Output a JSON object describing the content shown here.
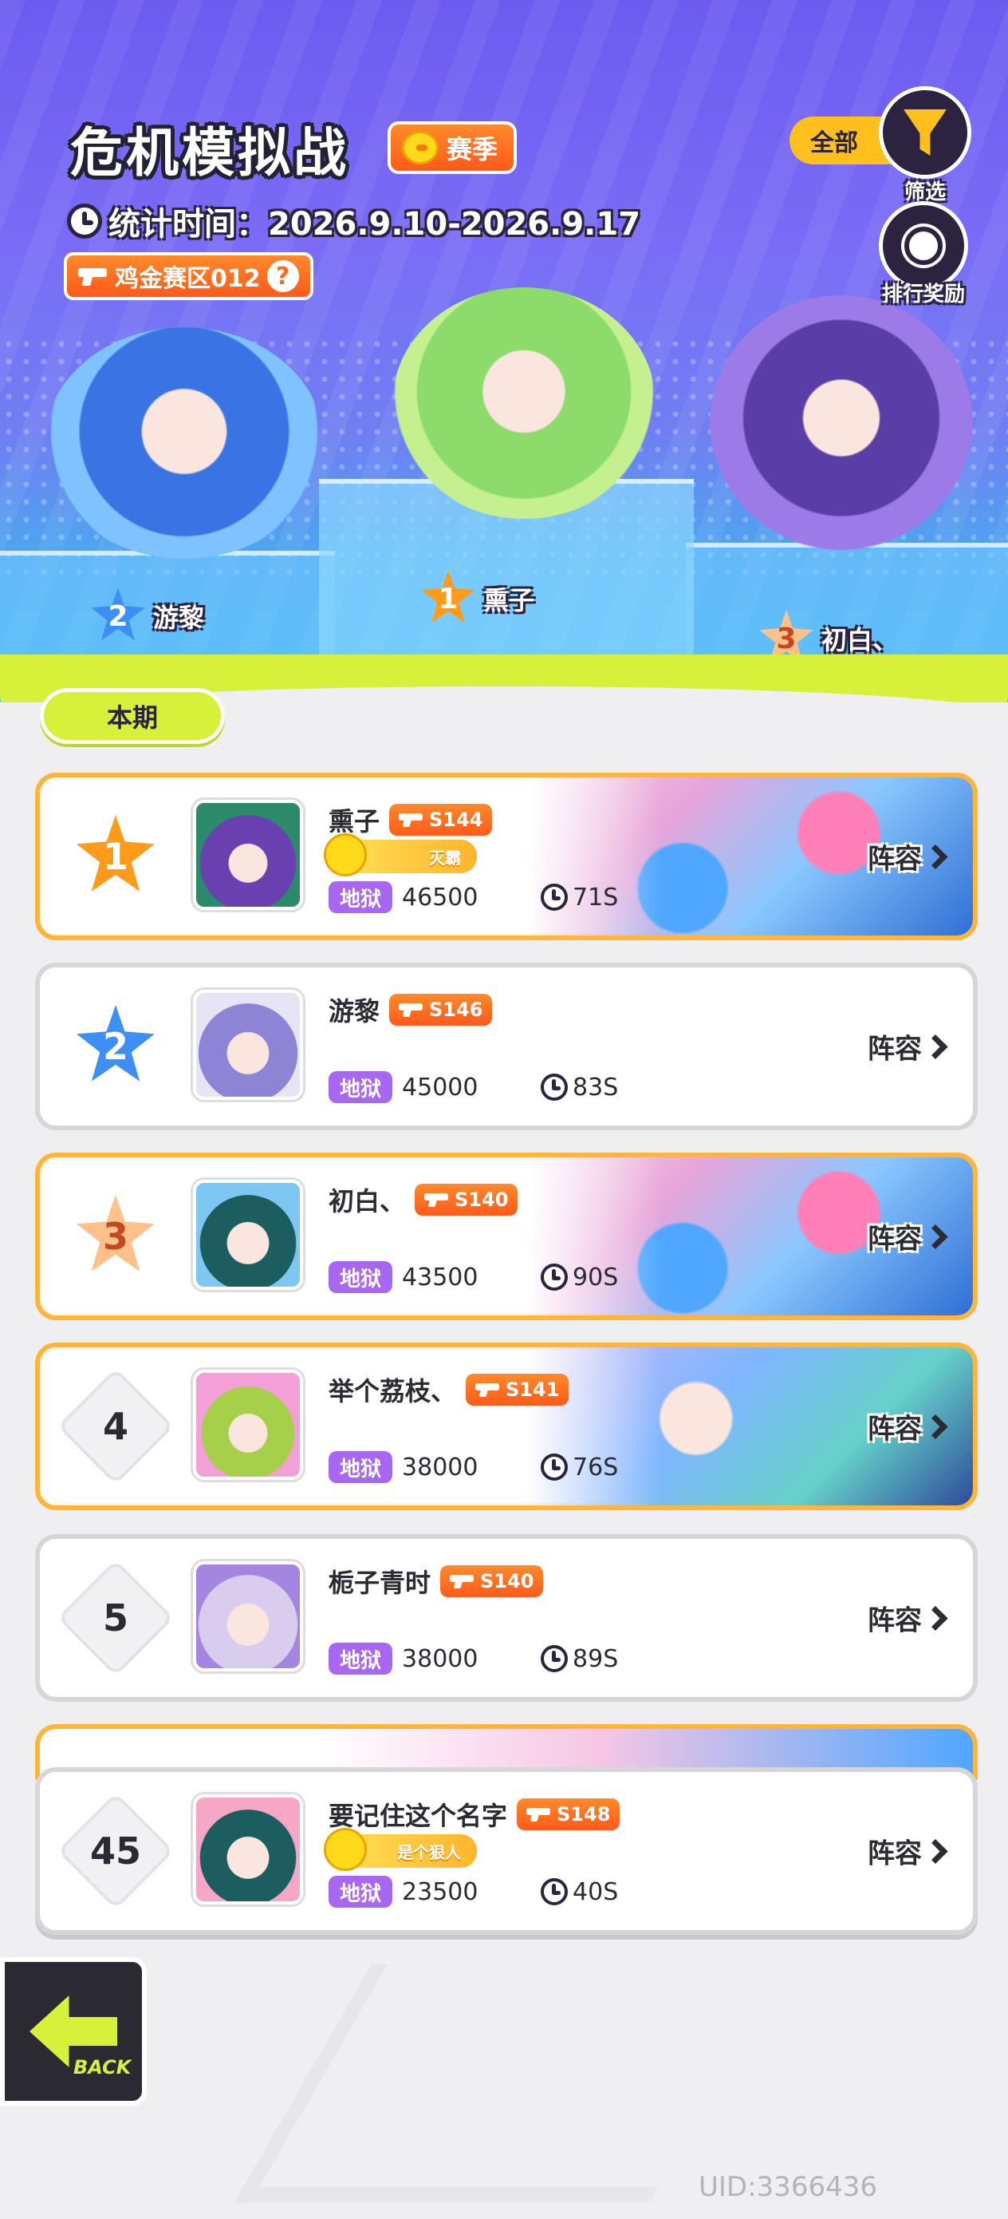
{
  "header": {
    "title": "危机模拟战",
    "season_label": "赛季",
    "stat_time": "统计时间：2026.9.10-2026.9.17",
    "zone_label": "鸡金赛区012",
    "zone_help": "?",
    "filter_value": "全部",
    "filter_label": "筛选",
    "reward_label": "排行奖励"
  },
  "podium": [
    {
      "rank": "2",
      "name": "游黎"
    },
    {
      "rank": "1",
      "name": "熏子"
    },
    {
      "rank": "3",
      "name": "初白、"
    }
  ],
  "tab": {
    "label": "本期"
  },
  "lineup_label": "阵容",
  "rows": [
    {
      "rank": "1",
      "name": "熏子",
      "level": "S144",
      "title_tag": "灭霸",
      "difficulty": "地狱",
      "score": "46500",
      "time": "71S",
      "style": "gold"
    },
    {
      "rank": "2",
      "name": "游黎",
      "level": "S146",
      "title_tag": "",
      "difficulty": "地狱",
      "score": "45000",
      "time": "83S",
      "style": "plain"
    },
    {
      "rank": "3",
      "name": "初白、",
      "level": "S140",
      "title_tag": "",
      "difficulty": "地狱",
      "score": "43500",
      "time": "90S",
      "style": "gold"
    },
    {
      "rank": "4",
      "name": "举个荔枝、",
      "level": "S141",
      "title_tag": "",
      "difficulty": "地狱",
      "score": "38000",
      "time": "76S",
      "style": "gold"
    },
    {
      "rank": "5",
      "name": "栀子青时",
      "level": "S140",
      "title_tag": "",
      "difficulty": "地狱",
      "score": "38000",
      "time": "89S",
      "style": "plain"
    }
  ],
  "my_row": {
    "rank": "45",
    "name": "要记住这个名字",
    "level": "S148",
    "title_tag": "是个狠人",
    "difficulty": "地狱",
    "score": "23500",
    "time": "40S"
  },
  "back_label": "BACK",
  "uid": "UID:3366436",
  "colors": {
    "accent_gold": "#ffb43a",
    "slime": "#d7f13b",
    "difficulty": "#a867f0",
    "level_badge": "#ff6a1f"
  }
}
